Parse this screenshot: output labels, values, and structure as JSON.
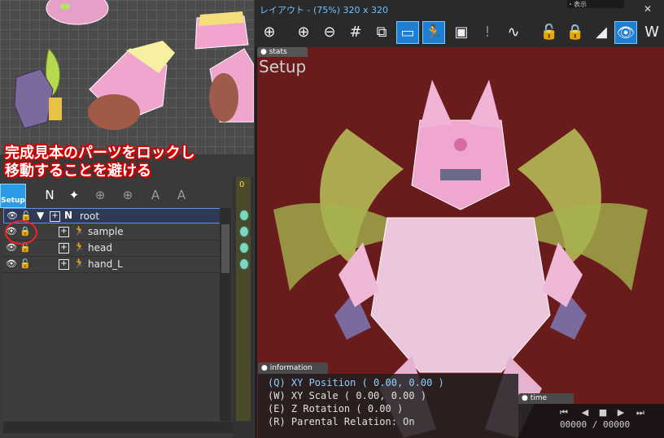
{
  "annotation": {
    "line1": "完成見本のパーツをロックし",
    "line2": "移動することを避ける"
  },
  "tree_toolbar": {
    "setup_label": "Setup"
  },
  "tree": {
    "rows": [
      {
        "name": "root",
        "icon": "null-bone-icon",
        "selected": true,
        "locked": false
      },
      {
        "name": "sample",
        "icon": "bone-person-icon",
        "selected": false,
        "locked": true
      },
      {
        "name": "head",
        "icon": "bone-person-icon",
        "selected": false,
        "locked": false
      },
      {
        "name": "hand_L",
        "icon": "bone-person-icon",
        "selected": false,
        "locked": false
      }
    ]
  },
  "timeline": {
    "frame": "0"
  },
  "layout_window": {
    "title": "レイアウト - (75%) 320 x 320",
    "tab_corner": "・表示",
    "stats_tab": "stats",
    "mode_label": "Setup",
    "toolbar_icons": [
      "crosshair-icon",
      "zoom-in-icon",
      "zoom-out-icon",
      "grid-icon",
      "image-crop-icon",
      "frame-icon",
      "bone-pose-icon",
      "export-frame-icon",
      "info-box-icon",
      "curve-icon",
      "lock-up-icon",
      "lock-rotate-icon",
      "weight-icon",
      "eye-toggle-icon",
      "weight-paint-icon"
    ]
  },
  "information": {
    "tab": "information",
    "lines": [
      "(Q) XY Position ( 0.00, 0.00 )",
      "(W) XY Scale ( 0.00, 0.00 )",
      "(E) Z Rotation ( 0.00 )",
      "(R) Parental Relation: On"
    ]
  },
  "time_panel": {
    "tab": "time",
    "current": "00000",
    "separator": "/",
    "total": "00000"
  },
  "colors": {
    "accent": "#2b9be6",
    "viewport_bg": "#6a1c1c",
    "annotation_red": "#d40000",
    "highlight_circle": "#ff1e1e"
  }
}
